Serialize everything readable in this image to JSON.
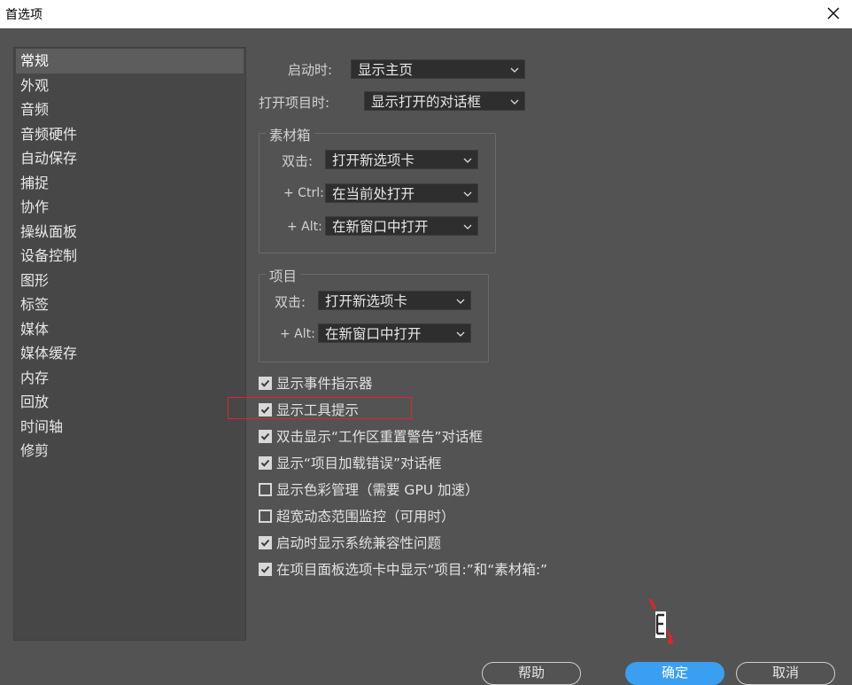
{
  "window": {
    "title": "首选项",
    "close_icon": "close-icon"
  },
  "sidebar": {
    "items": [
      {
        "label": "常规",
        "active": true
      },
      {
        "label": "外观"
      },
      {
        "label": "音频"
      },
      {
        "label": "音频硬件"
      },
      {
        "label": "自动保存"
      },
      {
        "label": "捕捉"
      },
      {
        "label": "协作"
      },
      {
        "label": "操纵面板"
      },
      {
        "label": "设备控制"
      },
      {
        "label": "图形"
      },
      {
        "label": "标签"
      },
      {
        "label": "媒体"
      },
      {
        "label": "媒体缓存"
      },
      {
        "label": "内存"
      },
      {
        "label": "回放"
      },
      {
        "label": "时间轴"
      },
      {
        "label": "修剪"
      }
    ]
  },
  "general": {
    "startup_label": "启动时:",
    "startup_value": "显示主页",
    "open_project_label": "打开项目时:",
    "open_project_value": "显示打开的对话框"
  },
  "bins": {
    "title": "素材箱",
    "dblclick_label": "双击:",
    "dblclick_value": "打开新选项卡",
    "ctrl_label": "+ Ctrl:",
    "ctrl_value": "在当前处打开",
    "alt_label": "+ Alt:",
    "alt_value": "在新窗口中打开"
  },
  "project": {
    "title": "项目",
    "dblclick_label": "双击:",
    "dblclick_value": "打开新选项卡",
    "alt_label": "+ Alt:",
    "alt_value": "在新窗口中打开"
  },
  "checkboxes": [
    {
      "label": "显示事件指示器",
      "checked": true
    },
    {
      "label": "显示工具提示",
      "checked": true
    },
    {
      "label": "双击显示“工作区重置警告”对话框",
      "checked": true
    },
    {
      "label": "显示“项目加载错误”对话框",
      "checked": true
    },
    {
      "label": "显示色彩管理（需要 GPU 加速）",
      "checked": false
    },
    {
      "label": "超宽动态范围监控（可用时）",
      "checked": false
    },
    {
      "label": "启动时显示系统兼容性问题",
      "checked": true
    },
    {
      "label": "在项目面板选项卡中显示“项目:”和“素材箱:”",
      "checked": true
    }
  ],
  "buttons": {
    "help": "帮助",
    "ok": "确定",
    "cancel": "取消"
  },
  "colors": {
    "accent": "#3a9ff0",
    "highlight": "#e2232a",
    "background": "#535353"
  }
}
